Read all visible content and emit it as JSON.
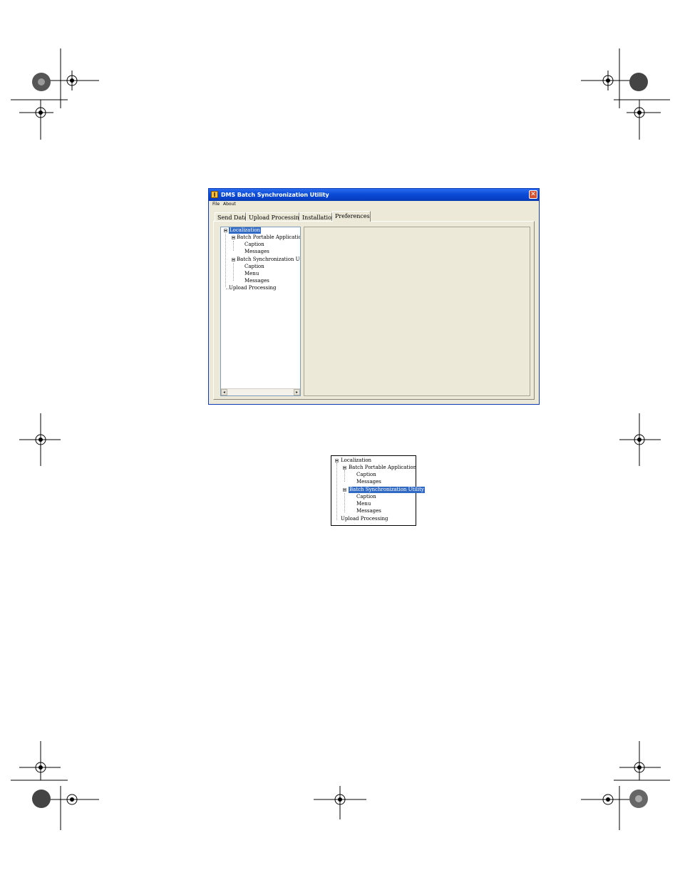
{
  "window": {
    "title": "DMS Batch Synchronization Utility",
    "close_glyph": "✕",
    "menu": [
      "File",
      "About"
    ],
    "tabs": [
      "Send Data",
      "Upload Processing",
      "Installation",
      "Preferences"
    ],
    "active_tab": "Preferences",
    "tree": {
      "root": "Localization",
      "group1": "Batch Portable Application",
      "group1_children": [
        "Caption",
        "Messages"
      ],
      "group2": "Batch Synchronization Utility",
      "group2_children": [
        "Caption",
        "Menu",
        "Messages"
      ],
      "upload": "Upload Processing",
      "selected": "Localization"
    },
    "scroll_left": "◂",
    "scroll_right": "▸"
  },
  "zoom_tree": {
    "root": "Localization",
    "group1": "Batch Portable Application",
    "group1_children": [
      "Caption",
      "Messages"
    ],
    "group2": "Batch Synchronization Utility",
    "group2_children": [
      "Caption",
      "Menu",
      "Messages"
    ],
    "upload": "Upload Processing",
    "selected": "Batch Synchronization Utility"
  },
  "colors": {
    "titlebar": "#0a4bd6",
    "selection": "#316ac5",
    "window_bg": "#ece9d8"
  }
}
